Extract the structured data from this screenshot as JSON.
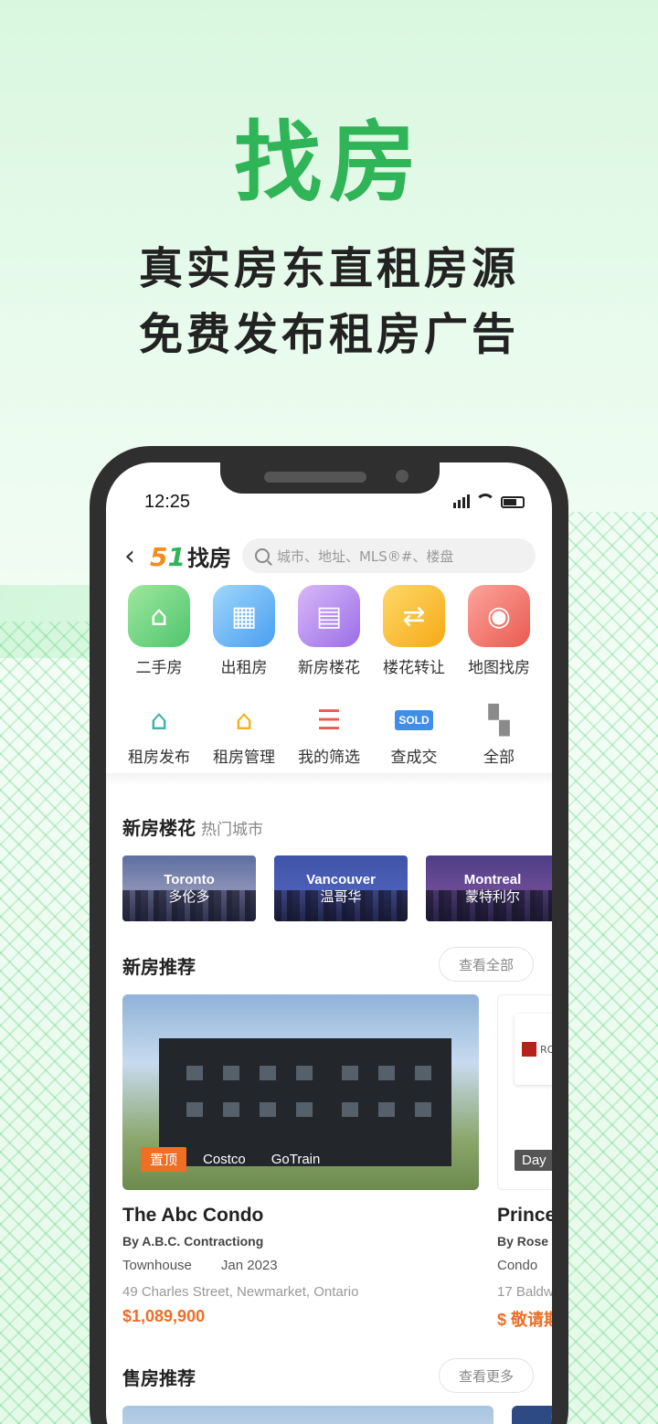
{
  "promo": {
    "headline": "找房",
    "line1": "真实房东直租房源",
    "line2": "免费发布租房广告"
  },
  "status_bar": {
    "time": "12:25"
  },
  "topbar": {
    "logo_num5": "5",
    "logo_num1": "1",
    "logo_text": "找房",
    "search_placeholder": "城市、地址、MLS®#、楼盘"
  },
  "main_icons": [
    {
      "label": "二手房",
      "icon": "house-icon"
    },
    {
      "label": "出租房",
      "icon": "building-icon"
    },
    {
      "label": "新房楼花",
      "icon": "new-building-icon"
    },
    {
      "label": "楼花转让",
      "icon": "transfer-icon"
    },
    {
      "label": "地图找房",
      "icon": "map-pin-icon"
    }
  ],
  "tool_icons": [
    {
      "label": "租房发布",
      "icon": "edit-house-icon"
    },
    {
      "label": "租房管理",
      "icon": "gear-house-icon"
    },
    {
      "label": "我的筛选",
      "icon": "filter-icon"
    },
    {
      "label": "查成交",
      "icon": "sold-icon"
    },
    {
      "label": "全部",
      "icon": "grid-icon"
    }
  ],
  "new_homes": {
    "title": "新房楼花",
    "subtitle": "热门城市",
    "cities": [
      {
        "en": "Toronto",
        "zh": "多伦多"
      },
      {
        "en": "Vancouver",
        "zh": "温哥华"
      },
      {
        "en": "Montreal",
        "zh": "蒙特利尔"
      }
    ]
  },
  "recommend": {
    "title": "新房推荐",
    "more": "查看全部",
    "cards": [
      {
        "tag_top": "置顶",
        "tags": [
          "Costco",
          "GoTrain"
        ],
        "name": "The Abc Condo",
        "developer": "By A.B.C. Contractiong",
        "type": "Townhouse",
        "date": "Jan 2023",
        "address": "49 Charles Street, Newmarket, Ontario",
        "price": "$1,089,900"
      },
      {
        "tag": "Day",
        "logo_text": "ROS DEVE",
        "name": "Prince",
        "developer": "By Rose",
        "type": "Condo",
        "address": "17 Baldw",
        "price": "$ 敬请期"
      }
    ]
  },
  "sale": {
    "title": "售房推荐",
    "more": "查看更多"
  }
}
